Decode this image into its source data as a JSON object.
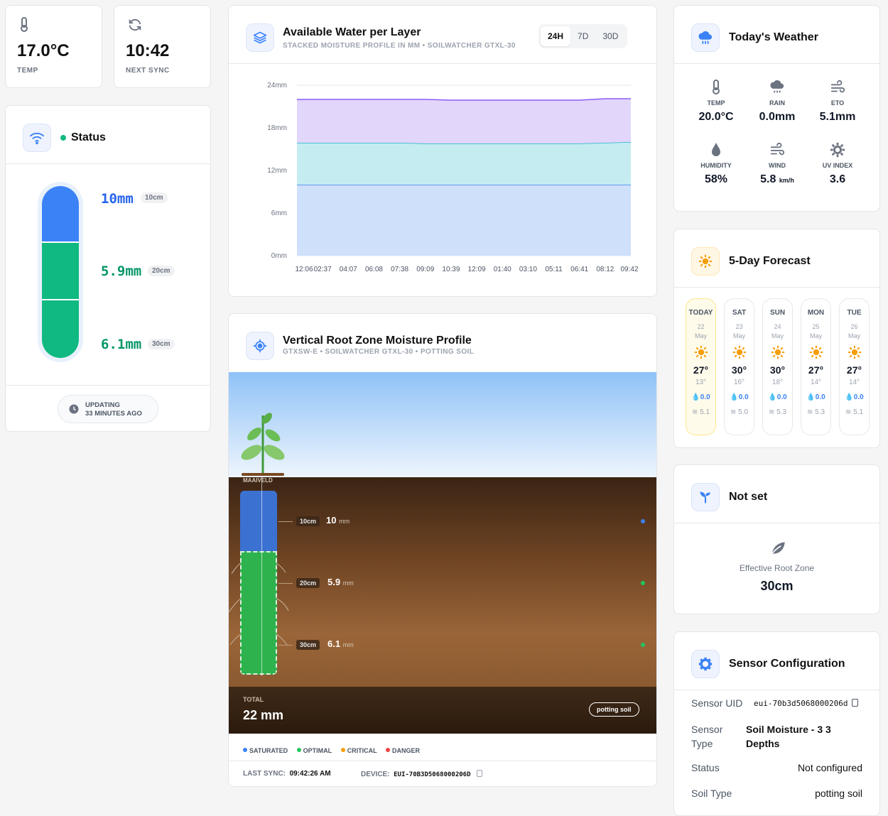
{
  "temp_card": {
    "value": "17.0°C",
    "label": "TEMP",
    "icon": "thermometer-icon"
  },
  "sync_card": {
    "value": "10:42",
    "label": "NEXT SYNC",
    "icon": "refresh-icon"
  },
  "status": {
    "title": "Status",
    "indicator_color": "#10b981",
    "layers": [
      {
        "value": "10mm",
        "depth": "10cm",
        "color": "#3b82f6"
      },
      {
        "value": "5.9mm",
        "depth": "20cm",
        "color": "#10b981"
      },
      {
        "value": "6.1mm",
        "depth": "30cm",
        "color": "#10b981"
      }
    ],
    "updating": "UPDATING\n33 MINUTES AGO"
  },
  "water_chart": {
    "title": "Available Water per Layer",
    "subtitle": "STACKED MOISTURE PROFILE IN MM • SOILWATCHER GTXL-30",
    "ranges": [
      "24H",
      "7D",
      "30D"
    ],
    "active_range": "24H"
  },
  "chart_data": {
    "type": "area",
    "stacked": true,
    "title": "Available Water per Layer",
    "x": [
      "12:06",
      "02:37",
      "04:07",
      "06:08",
      "07:38",
      "09:09",
      "10:39",
      "12:09",
      "01:40",
      "03:10",
      "05:11",
      "06:41",
      "08:12",
      "09:42"
    ],
    "ylim": [
      0,
      24
    ],
    "yticks": [
      "0mm",
      "6mm",
      "12mm",
      "18mm",
      "24mm"
    ],
    "grid": true,
    "series": [
      {
        "name": "10cm",
        "color": "#cfe0fb",
        "line": "#3b82f6",
        "values": [
          10,
          10,
          10,
          10,
          10,
          10,
          10,
          10,
          10,
          10,
          10,
          10,
          10,
          10
        ]
      },
      {
        "name": "20cm",
        "color": "#c4ecf1",
        "line": "#22b3cc",
        "values": [
          5.9,
          5.9,
          5.9,
          5.9,
          5.9,
          5.8,
          5.8,
          5.8,
          5.8,
          5.8,
          5.8,
          5.8,
          5.9,
          6.0
        ]
      },
      {
        "name": "30cm",
        "color": "#e2d6fb",
        "line": "#8b5cf6",
        "values": [
          6.1,
          6.1,
          6.1,
          6.1,
          6.1,
          6.2,
          6.1,
          6.1,
          6.1,
          6.1,
          6.1,
          6.1,
          6.2,
          6.1
        ]
      }
    ]
  },
  "root_profile": {
    "title": "Vertical Root Zone Moisture Profile",
    "subtitle": "GTXSW-E • SOILWATCHER GTXL-30 • POTTING SOIL",
    "surface_label": "MAAIVELD",
    "layers": [
      {
        "depth": "10cm",
        "value": "10",
        "unit": "mm",
        "dot": "#3b82f6"
      },
      {
        "depth": "20cm",
        "value": "5.9",
        "unit": "mm",
        "dot": "#22c55e"
      },
      {
        "depth": "30cm",
        "value": "6.1",
        "unit": "mm",
        "dot": "#22c55e"
      }
    ],
    "total_label": "TOTAL",
    "total_value": "22 mm",
    "soil_badge": "potting soil",
    "legend": [
      {
        "label": "SATURATED",
        "color": "#3b82f6"
      },
      {
        "label": "OPTIMAL",
        "color": "#22c55e"
      },
      {
        "label": "CRITICAL",
        "color": "#f59e0b"
      },
      {
        "label": "DANGER",
        "color": "#ef4444"
      }
    ],
    "last_sync_label": "LAST SYNC:",
    "last_sync_value": "09:42:26 AM",
    "device_label": "DEVICE:",
    "device_value": "EUI-70B3D5068000206D"
  },
  "weather": {
    "title": "Today's Weather",
    "items": [
      {
        "label": "TEMP",
        "value": "20.0°C",
        "icon": "thermometer-icon"
      },
      {
        "label": "RAIN",
        "value": "0.0mm",
        "icon": "rain-cloud-icon"
      },
      {
        "label": "ETO",
        "value": "5.1mm",
        "icon": "wind-icon"
      },
      {
        "label": "HUMIDITY",
        "value": "58%",
        "icon": "droplet-icon"
      },
      {
        "label": "WIND",
        "value": "5.8",
        "unit": "km/h",
        "icon": "wind-icon"
      },
      {
        "label": "UV INDEX",
        "value": "3.6",
        "icon": "sun-gear-icon"
      }
    ]
  },
  "forecast": {
    "title": "5-Day Forecast",
    "days": [
      {
        "name": "TODAY",
        "date": "22",
        "month": "May",
        "hi": "27°",
        "lo": "13°",
        "rain": "0.0",
        "eto": "5.1"
      },
      {
        "name": "SAT",
        "date": "23",
        "month": "May",
        "hi": "30°",
        "lo": "16°",
        "rain": "0.0",
        "eto": "5.0"
      },
      {
        "name": "SUN",
        "date": "24",
        "month": "May",
        "hi": "30°",
        "lo": "18°",
        "rain": "0.0",
        "eto": "5.3"
      },
      {
        "name": "MON",
        "date": "25",
        "month": "May",
        "hi": "27°",
        "lo": "14°",
        "rain": "0.0",
        "eto": "5.3"
      },
      {
        "name": "TUE",
        "date": "26",
        "month": "May",
        "hi": "27°",
        "lo": "14°",
        "rain": "0.0",
        "eto": "5.1"
      }
    ]
  },
  "crop": {
    "title": "Not set",
    "root_label": "Effective Root Zone",
    "root_value": "30cm"
  },
  "sensor_config": {
    "title": "Sensor Configuration",
    "uid_label": "Sensor UID",
    "uid_value": "eui-70b3d5068000206d",
    "type_label": "Sensor\nType",
    "type_value": "Soil Moisture - 3 3\nDepths",
    "status_label": "Status",
    "status_value": "Not configured",
    "soil_label": "Soil Type",
    "soil_value": "potting soil"
  }
}
